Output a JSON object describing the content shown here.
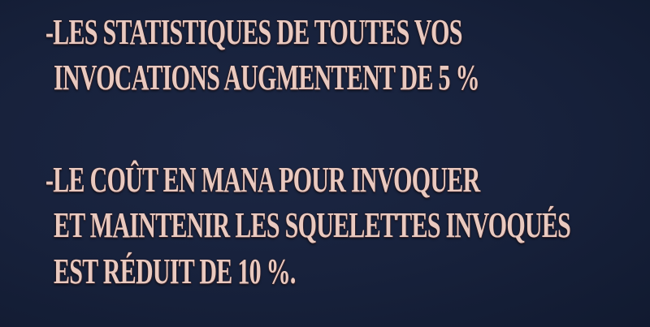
{
  "bonuses": [
    {
      "lines": [
        "-LES STATISTIQUES DE TOUTES VOS",
        "INVOCATIONS AUGMENTENT DE 5 %"
      ]
    },
    {
      "lines": [
        "-LE COÛT EN MANA POUR INVOQUER",
        "ET MAINTENIR LES SQUELETTES INVOQUÉS",
        "EST RÉDUIT DE 10 %."
      ]
    }
  ]
}
